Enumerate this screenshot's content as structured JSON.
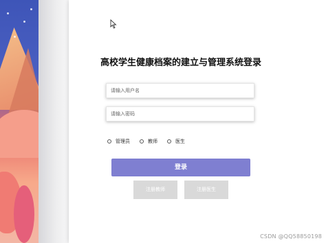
{
  "title": "高校学生健康档案的建立与管理系统登录",
  "username_placeholder": "请输入用户名",
  "password_placeholder": "请输入密码",
  "roles": [
    {
      "label": "管理员"
    },
    {
      "label": "教师"
    },
    {
      "label": "医生"
    }
  ],
  "login_label": "登录",
  "register_teacher_label": "注册教师",
  "register_doctor_label": "注册医生",
  "watermark": "CSDN @QQ58850198",
  "colors": {
    "primary_button": "#7f7fd1",
    "secondary_button": "#d9d9d9"
  }
}
